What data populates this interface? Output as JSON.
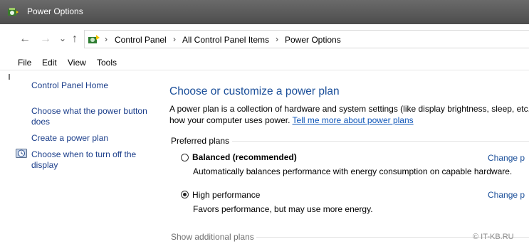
{
  "window": {
    "title": "Power Options"
  },
  "nav": {
    "back": "←",
    "forward": "→",
    "recent": "⌄",
    "up": "↑"
  },
  "address": {
    "sep": "›",
    "crumbs": [
      "Control Panel",
      "All Control Panel Items",
      "Power Options"
    ]
  },
  "menu": [
    "File",
    "Edit",
    "View",
    "Tools"
  ],
  "sidebar": {
    "home": "Control Panel Home",
    "items": [
      {
        "line1": "Choose what the power button",
        "line2": "does"
      },
      {
        "line1": "Create a power plan"
      },
      {
        "line1": "Choose when to turn off the",
        "line2": "display",
        "icon": "clock-icon"
      }
    ]
  },
  "main": {
    "heading": "Choose or customize a power plan",
    "description_line1": "A power plan is a collection of hardware and system settings (like display brightness, sleep, etc.",
    "description_line2_prefix": "how your computer uses power.",
    "description_link": "Tell me more about power plans",
    "preferred_plans_label": "Preferred plans",
    "plans": [
      {
        "name": "Balanced (recommended)",
        "description": "Automatically balances performance with energy consumption on capable hardware.",
        "selected": false,
        "change_label": "Change p"
      },
      {
        "name": "High performance",
        "description": "Favors performance, but may use more energy.",
        "selected": true,
        "change_label": "Change p"
      }
    ],
    "show_additional": "Show additional plans"
  },
  "watermark": "© IT-KB.RU",
  "colors": {
    "titlebar": "#555555",
    "link": "#1a3d8a",
    "heading": "#1a4e99"
  }
}
